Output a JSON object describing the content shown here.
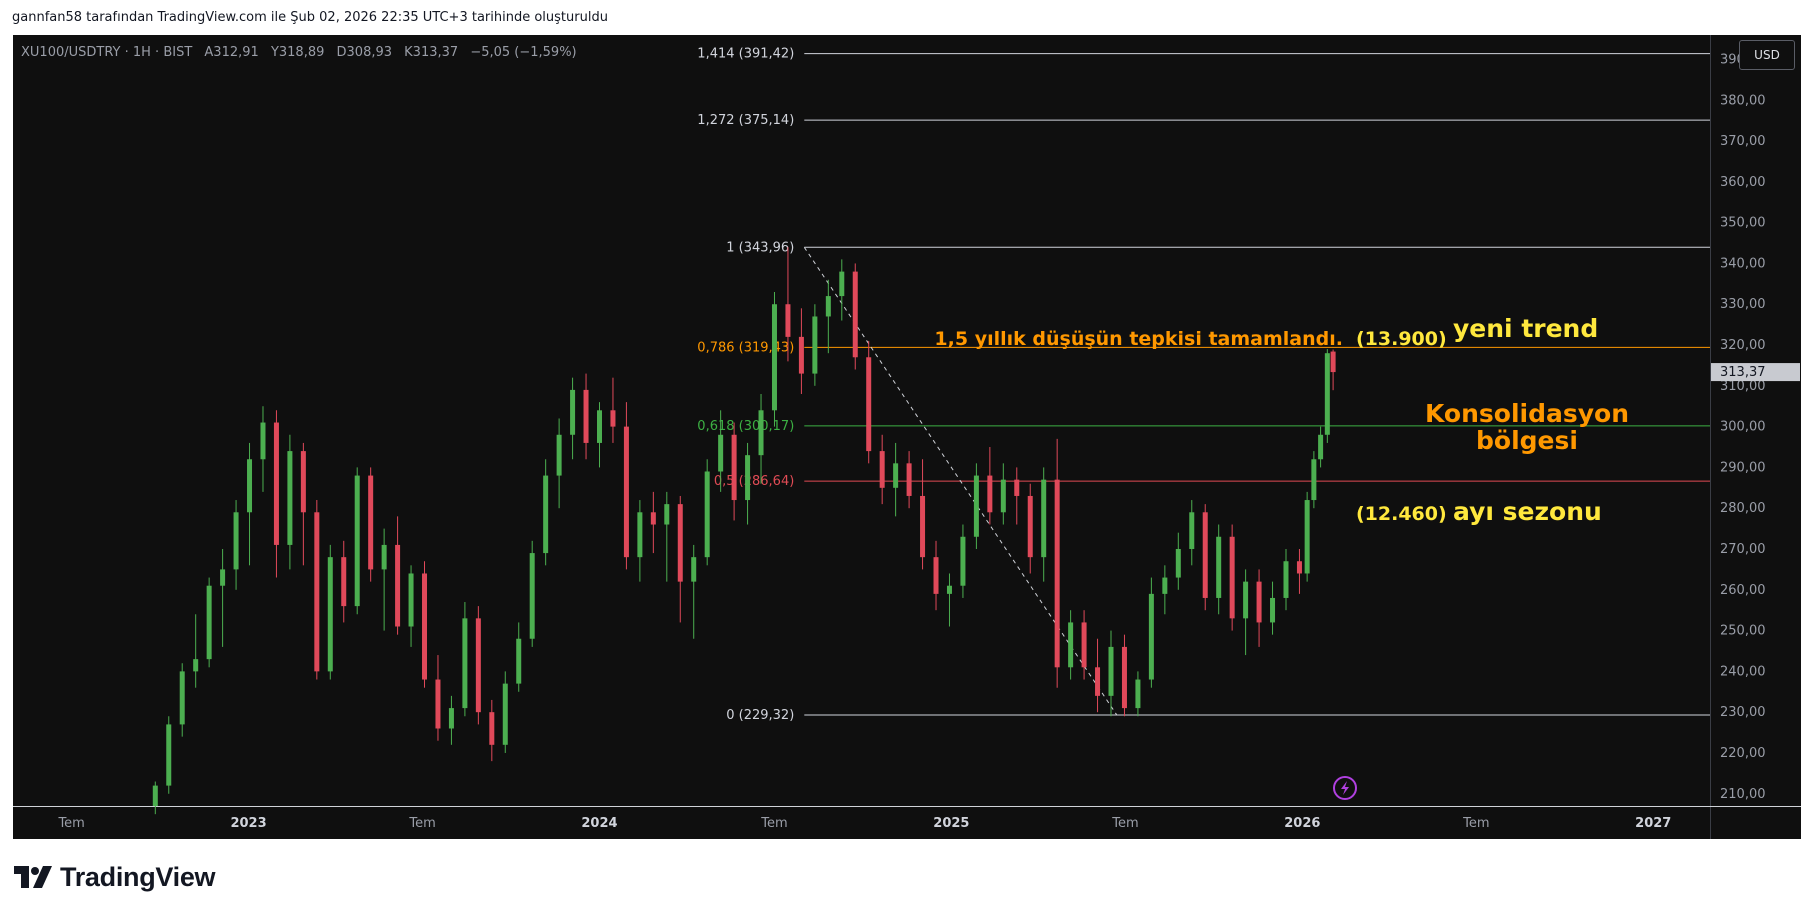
{
  "credit_line": "gannfan58 tarafından TradingView.com ile Şub 02, 2026 22:35 UTC+3 tarihinde oluşturuldu",
  "symbol_header": {
    "symbol": "XU100/USDTRY · 1H · BIST",
    "open": "A312,91",
    "high": "Y318,89",
    "low": "D308,93",
    "close": "K313,37",
    "change": "−5,05 (−1,59%)"
  },
  "currency_button": "USD",
  "brand": {
    "name": "TradingView",
    "icon": "tradingview-logo-icon"
  },
  "alert_icon": "lightning-alert-icon",
  "colors": {
    "background": "#0f0f0f",
    "up_candle": "#4caf50",
    "down_candle": "#e0495a",
    "fib_0786": "#ff9800",
    "fib_0618": "#3cb043",
    "fib_05": "#e04b55",
    "annotation_orange": "#ff9800",
    "annotation_yellow": "#ffe83d",
    "alert_icon": "#b040e0"
  },
  "chart_data": {
    "type": "candlestick",
    "price_axis": {
      "range": [
        207,
        396
      ],
      "ticks": [
        "390,00",
        "380,00",
        "370,00",
        "360,00",
        "350,00",
        "340,00",
        "330,00",
        "320,00",
        "310,00",
        "300,00",
        "290,00",
        "280,00",
        "270,00",
        "260,00",
        "250,00",
        "240,00",
        "230,00",
        "220,00",
        "210,00"
      ],
      "tick_values": [
        390,
        380,
        370,
        360,
        350,
        340,
        330,
        320,
        310,
        300,
        290,
        280,
        270,
        260,
        250,
        240,
        230,
        220,
        210
      ],
      "last_price": {
        "label": "313,37",
        "value": 313.37
      }
    },
    "time_axis": {
      "range": [
        "2022-05-01",
        "2027-03-01"
      ],
      "ticks": [
        {
          "label": "Tem",
          "date": "2022-07-01"
        },
        {
          "label": "2023",
          "date": "2023-01-01"
        },
        {
          "label": "Tem",
          "date": "2023-07-01"
        },
        {
          "label": "2024",
          "date": "2024-01-01"
        },
        {
          "label": "Tem",
          "date": "2024-07-01"
        },
        {
          "label": "2025",
          "date": "2025-01-01"
        },
        {
          "label": "Tem",
          "date": "2025-07-01"
        },
        {
          "label": "2026",
          "date": "2026-01-01"
        },
        {
          "label": "Tem",
          "date": "2026-07-01"
        },
        {
          "label": "2027",
          "date": "2027-01-01"
        }
      ]
    },
    "fib_start_date": "2024-08-01",
    "fib_end_date": "2027-03-01",
    "fib_levels": [
      {
        "label": "1,414 (391,42)",
        "value": 391.42,
        "color": "#d1d4dc",
        "ratio": 1.414
      },
      {
        "label": "1,272 (375,14)",
        "value": 375.14,
        "color": "#d1d4dc",
        "ratio": 1.272
      },
      {
        "label": "1 (343,96)",
        "value": 343.96,
        "color": "#d1d4dc",
        "ratio": 1
      },
      {
        "label": "0,786 (319,43)",
        "value": 319.43,
        "color": "#ff9800",
        "ratio": 0.786
      },
      {
        "label": "0,618 (300,17)",
        "value": 300.17,
        "color": "#3cb043",
        "ratio": 0.618
      },
      {
        "label": "0,5 (286,64)",
        "value": 286.64,
        "color": "#e04b55",
        "ratio": 0.5
      },
      {
        "label": "0 (229,32)",
        "value": 229.32,
        "color": "#d1d4dc",
        "ratio": 0
      }
    ],
    "trend_line": {
      "from": {
        "date": "2024-08-01",
        "value": 343.96
      },
      "to": {
        "date": "2025-06-22",
        "value": 229.32
      }
    },
    "annotations": [
      {
        "text": "1,5 yıllık düşüşün tepkisi tamamlandı.",
        "color": "#ff9800"
      },
      {
        "text": "(13.900)",
        "color": "#ffe83d"
      },
      {
        "text": "yeni trend",
        "color": "#ffe83d"
      },
      {
        "text": "Konsolidasyon",
        "color": "#ff9800"
      },
      {
        "text": "bölgesi",
        "color": "#ff9800"
      },
      {
        "text": "(12.460)",
        "color": "#ffe83d"
      },
      {
        "text": "ayı sezonu",
        "color": "#ffe83d"
      }
    ],
    "candles": [
      {
        "d": "2022-09-26",
        "o": 207,
        "h": 213,
        "l": 205,
        "c": 212
      },
      {
        "d": "2022-10-10",
        "o": 212,
        "h": 229,
        "l": 210,
        "c": 227
      },
      {
        "d": "2022-10-24",
        "o": 227,
        "h": 242,
        "l": 224,
        "c": 240
      },
      {
        "d": "2022-11-07",
        "o": 240,
        "h": 254,
        "l": 236,
        "c": 243
      },
      {
        "d": "2022-11-21",
        "o": 243,
        "h": 263,
        "l": 241,
        "c": 261
      },
      {
        "d": "2022-12-05",
        "o": 261,
        "h": 270,
        "l": 246,
        "c": 265
      },
      {
        "d": "2022-12-19",
        "o": 265,
        "h": 282,
        "l": 260,
        "c": 279
      },
      {
        "d": "2023-01-02",
        "o": 279,
        "h": 296,
        "l": 266,
        "c": 292
      },
      {
        "d": "2023-01-16",
        "o": 292,
        "h": 305,
        "l": 284,
        "c": 301
      },
      {
        "d": "2023-01-30",
        "o": 301,
        "h": 304,
        "l": 263,
        "c": 271
      },
      {
        "d": "2023-02-13",
        "o": 271,
        "h": 298,
        "l": 265,
        "c": 294
      },
      {
        "d": "2023-02-27",
        "o": 294,
        "h": 296,
        "l": 266,
        "c": 279
      },
      {
        "d": "2023-03-13",
        "o": 279,
        "h": 282,
        "l": 238,
        "c": 240
      },
      {
        "d": "2023-03-27",
        "o": 240,
        "h": 271,
        "l": 238,
        "c": 268
      },
      {
        "d": "2023-04-10",
        "o": 268,
        "h": 272,
        "l": 252,
        "c": 256
      },
      {
        "d": "2023-04-24",
        "o": 256,
        "h": 290,
        "l": 254,
        "c": 288
      },
      {
        "d": "2023-05-08",
        "o": 288,
        "h": 290,
        "l": 262,
        "c": 265
      },
      {
        "d": "2023-05-22",
        "o": 265,
        "h": 275,
        "l": 250,
        "c": 271
      },
      {
        "d": "2023-06-05",
        "o": 271,
        "h": 278,
        "l": 249,
        "c": 251
      },
      {
        "d": "2023-06-19",
        "o": 251,
        "h": 266,
        "l": 246,
        "c": 264
      },
      {
        "d": "2023-07-03",
        "o": 264,
        "h": 267,
        "l": 236,
        "c": 238
      },
      {
        "d": "2023-07-17",
        "o": 238,
        "h": 244,
        "l": 223,
        "c": 226
      },
      {
        "d": "2023-07-31",
        "o": 226,
        "h": 234,
        "l": 222,
        "c": 231
      },
      {
        "d": "2023-08-14",
        "o": 231,
        "h": 257,
        "l": 229,
        "c": 253
      },
      {
        "d": "2023-08-28",
        "o": 253,
        "h": 256,
        "l": 227,
        "c": 230
      },
      {
        "d": "2023-09-11",
        "o": 230,
        "h": 233,
        "l": 218,
        "c": 222
      },
      {
        "d": "2023-09-25",
        "o": 222,
        "h": 240,
        "l": 220,
        "c": 237
      },
      {
        "d": "2023-10-09",
        "o": 237,
        "h": 252,
        "l": 235,
        "c": 248
      },
      {
        "d": "2023-10-23",
        "o": 248,
        "h": 272,
        "l": 246,
        "c": 269
      },
      {
        "d": "2023-11-06",
        "o": 269,
        "h": 292,
        "l": 266,
        "c": 288
      },
      {
        "d": "2023-11-20",
        "o": 288,
        "h": 302,
        "l": 280,
        "c": 298
      },
      {
        "d": "2023-12-04",
        "o": 298,
        "h": 312,
        "l": 292,
        "c": 309
      },
      {
        "d": "2023-12-18",
        "o": 309,
        "h": 313,
        "l": 292,
        "c": 296
      },
      {
        "d": "2024-01-01",
        "o": 296,
        "h": 306,
        "l": 290,
        "c": 304
      },
      {
        "d": "2024-01-15",
        "o": 304,
        "h": 312,
        "l": 296,
        "c": 300
      },
      {
        "d": "2024-01-29",
        "o": 300,
        "h": 306,
        "l": 265,
        "c": 268
      },
      {
        "d": "2024-02-12",
        "o": 268,
        "h": 282,
        "l": 262,
        "c": 279
      },
      {
        "d": "2024-02-26",
        "o": 279,
        "h": 284,
        "l": 269,
        "c": 276
      },
      {
        "d": "2024-03-11",
        "o": 276,
        "h": 284,
        "l": 262,
        "c": 281
      },
      {
        "d": "2024-03-25",
        "o": 281,
        "h": 283,
        "l": 252,
        "c": 262
      },
      {
        "d": "2024-04-08",
        "o": 262,
        "h": 271,
        "l": 248,
        "c": 268
      },
      {
        "d": "2024-04-22",
        "o": 268,
        "h": 292,
        "l": 266,
        "c": 289
      },
      {
        "d": "2024-05-06",
        "o": 289,
        "h": 304,
        "l": 284,
        "c": 298
      },
      {
        "d": "2024-05-20",
        "o": 298,
        "h": 301,
        "l": 277,
        "c": 282
      },
      {
        "d": "2024-06-03",
        "o": 282,
        "h": 296,
        "l": 276,
        "c": 293
      },
      {
        "d": "2024-06-17",
        "o": 293,
        "h": 308,
        "l": 286,
        "c": 304
      },
      {
        "d": "2024-07-01",
        "o": 304,
        "h": 333,
        "l": 300,
        "c": 330
      },
      {
        "d": "2024-07-15",
        "o": 330,
        "h": 344,
        "l": 316,
        "c": 322
      },
      {
        "d": "2024-07-29",
        "o": 322,
        "h": 329,
        "l": 308,
        "c": 313
      },
      {
        "d": "2024-08-12",
        "o": 313,
        "h": 330,
        "l": 310,
        "c": 327
      },
      {
        "d": "2024-08-26",
        "o": 327,
        "h": 336,
        "l": 318,
        "c": 332
      },
      {
        "d": "2024-09-09",
        "o": 332,
        "h": 341,
        "l": 326,
        "c": 338
      },
      {
        "d": "2024-09-23",
        "o": 338,
        "h": 340,
        "l": 314,
        "c": 317
      },
      {
        "d": "2024-10-07",
        "o": 317,
        "h": 321,
        "l": 291,
        "c": 294
      },
      {
        "d": "2024-10-21",
        "o": 294,
        "h": 298,
        "l": 281,
        "c": 285
      },
      {
        "d": "2024-11-04",
        "o": 285,
        "h": 296,
        "l": 278,
        "c": 291
      },
      {
        "d": "2024-11-18",
        "o": 291,
        "h": 294,
        "l": 280,
        "c": 283
      },
      {
        "d": "2024-12-02",
        "o": 283,
        "h": 292,
        "l": 265,
        "c": 268
      },
      {
        "d": "2024-12-16",
        "o": 268,
        "h": 272,
        "l": 255,
        "c": 259
      },
      {
        "d": "2024-12-30",
        "o": 259,
        "h": 264,
        "l": 251,
        "c": 261
      },
      {
        "d": "2025-01-13",
        "o": 261,
        "h": 276,
        "l": 258,
        "c": 273
      },
      {
        "d": "2025-01-27",
        "o": 273,
        "h": 291,
        "l": 270,
        "c": 288
      },
      {
        "d": "2025-02-10",
        "o": 288,
        "h": 295,
        "l": 276,
        "c": 279
      },
      {
        "d": "2025-02-24",
        "o": 279,
        "h": 291,
        "l": 276,
        "c": 287
      },
      {
        "d": "2025-03-10",
        "o": 287,
        "h": 290,
        "l": 276,
        "c": 283
      },
      {
        "d": "2025-03-24",
        "o": 283,
        "h": 286,
        "l": 264,
        "c": 268
      },
      {
        "d": "2025-04-07",
        "o": 268,
        "h": 290,
        "l": 262,
        "c": 287
      },
      {
        "d": "2025-04-21",
        "o": 287,
        "h": 297,
        "l": 236,
        "c": 241
      },
      {
        "d": "2025-05-05",
        "o": 241,
        "h": 255,
        "l": 238,
        "c": 252
      },
      {
        "d": "2025-05-19",
        "o": 252,
        "h": 255,
        "l": 238,
        "c": 241
      },
      {
        "d": "2025-06-02",
        "o": 241,
        "h": 248,
        "l": 230,
        "c": 234
      },
      {
        "d": "2025-06-16",
        "o": 234,
        "h": 250,
        "l": 229,
        "c": 246
      },
      {
        "d": "2025-06-30",
        "o": 246,
        "h": 249,
        "l": 229,
        "c": 231
      },
      {
        "d": "2025-07-14",
        "o": 231,
        "h": 240,
        "l": 229,
        "c": 238
      },
      {
        "d": "2025-07-28",
        "o": 238,
        "h": 263,
        "l": 236,
        "c": 259
      },
      {
        "d": "2025-08-11",
        "o": 259,
        "h": 266,
        "l": 254,
        "c": 263
      },
      {
        "d": "2025-08-25",
        "o": 263,
        "h": 274,
        "l": 260,
        "c": 270
      },
      {
        "d": "2025-09-08",
        "o": 270,
        "h": 282,
        "l": 266,
        "c": 279
      },
      {
        "d": "2025-09-22",
        "o": 279,
        "h": 281,
        "l": 255,
        "c": 258
      },
      {
        "d": "2025-10-06",
        "o": 258,
        "h": 276,
        "l": 254,
        "c": 273
      },
      {
        "d": "2025-10-20",
        "o": 273,
        "h": 276,
        "l": 250,
        "c": 253
      },
      {
        "d": "2025-11-03",
        "o": 253,
        "h": 265,
        "l": 244,
        "c": 262
      },
      {
        "d": "2025-11-17",
        "o": 262,
        "h": 265,
        "l": 246,
        "c": 252
      },
      {
        "d": "2025-12-01",
        "o": 252,
        "h": 262,
        "l": 249,
        "c": 258
      },
      {
        "d": "2025-12-15",
        "o": 258,
        "h": 270,
        "l": 255,
        "c": 267
      },
      {
        "d": "2025-12-29",
        "o": 267,
        "h": 270,
        "l": 259,
        "c": 264
      },
      {
        "d": "2026-01-06",
        "o": 264,
        "h": 284,
        "l": 262,
        "c": 282
      },
      {
        "d": "2026-01-13",
        "o": 282,
        "h": 294,
        "l": 280,
        "c": 292
      },
      {
        "d": "2026-01-20",
        "o": 292,
        "h": 300,
        "l": 290,
        "c": 298
      },
      {
        "d": "2026-01-27",
        "o": 298,
        "h": 319,
        "l": 296,
        "c": 318
      },
      {
        "d": "2026-02-02",
        "o": 318.4,
        "h": 318.89,
        "l": 308.93,
        "c": 313.37
      }
    ]
  }
}
